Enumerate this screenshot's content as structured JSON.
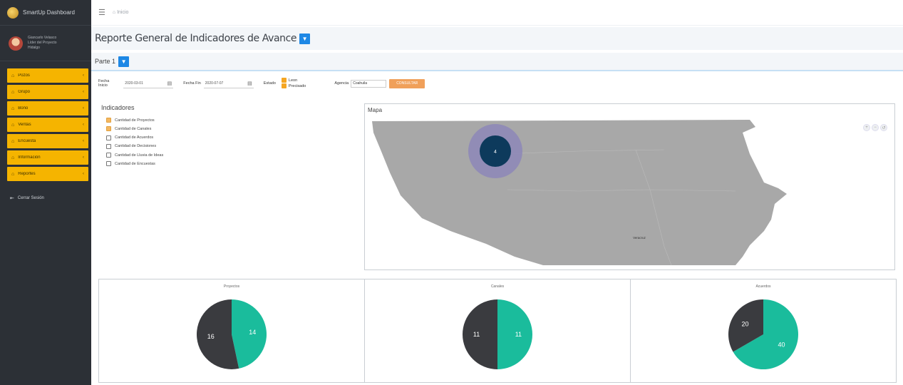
{
  "app": {
    "brand": "SmartUp Dashboard"
  },
  "user": {
    "name": "Giancarlo Velasco",
    "role": "Líder del Proyecto",
    "org": "Hidalgo"
  },
  "sidebar": {
    "items": [
      {
        "label": "Pozos",
        "icon": "home-icon"
      },
      {
        "label": "Grupo",
        "icon": "home-icon"
      },
      {
        "label": "Bono",
        "icon": "home-icon"
      },
      {
        "label": "Ventas",
        "icon": "home-icon"
      },
      {
        "label": "Encuesta",
        "icon": "home-icon"
      },
      {
        "label": "Información",
        "icon": "home-icon"
      },
      {
        "label": "Reportes",
        "icon": "home-icon"
      }
    ],
    "logout": "Cerrar Sesión"
  },
  "topbar": {
    "breadcrumb": "Inicio"
  },
  "page": {
    "title": "Reporte General de Indicadores de Avance",
    "part": "Parte 1"
  },
  "filters": {
    "start_label_1": "Fecha",
    "start_label_2": "Inicio",
    "start_value": "2020-03-01",
    "end_label": "Fecha Fin",
    "end_value": "2020-07-07",
    "estado_label": "Estado",
    "estado_options": [
      "Leon",
      "Precisado"
    ],
    "agency_label": "Agencia",
    "agency_value": "Coahuila",
    "search_button": "CONSULTAR"
  },
  "indicators": {
    "title": "Indicadores",
    "items": [
      {
        "label": "Cantidad de Proyectos",
        "checked": true
      },
      {
        "label": "Cantidad de Canales",
        "checked": true
      },
      {
        "label": "Cantidad de Acuerdos",
        "checked": false
      },
      {
        "label": "Cantidad de Decisiones",
        "checked": false
      },
      {
        "label": "Cantidad de Lluvia de Ideas",
        "checked": false
      },
      {
        "label": "Cantidad de Encuestas",
        "checked": false
      }
    ]
  },
  "map": {
    "title": "Mapa",
    "marker_value": "4",
    "region_label": "Veracruz",
    "land_color": "#a8a8a8",
    "marker_color": "#0d3a5c",
    "halo_color": "#8d87b8"
  },
  "colors": {
    "teal": "#1abc9c",
    "dark": "#3a3b3f",
    "sidebar": "#2c3036",
    "menu": "#f5b400"
  },
  "chart_data": [
    {
      "type": "pie",
      "title": "Proyectos",
      "slices": [
        {
          "value": 14,
          "color": "#1abc9c"
        },
        {
          "value": 16,
          "color": "#3a3b3f"
        }
      ]
    },
    {
      "type": "pie",
      "title": "Canales",
      "slices": [
        {
          "value": 11,
          "color": "#1abc9c"
        },
        {
          "value": 11,
          "color": "#3a3b3f"
        }
      ]
    },
    {
      "type": "pie",
      "title": "Acuerdos",
      "slices": [
        {
          "value": 40,
          "color": "#1abc9c"
        },
        {
          "value": 20,
          "color": "#3a3b3f"
        }
      ]
    }
  ]
}
